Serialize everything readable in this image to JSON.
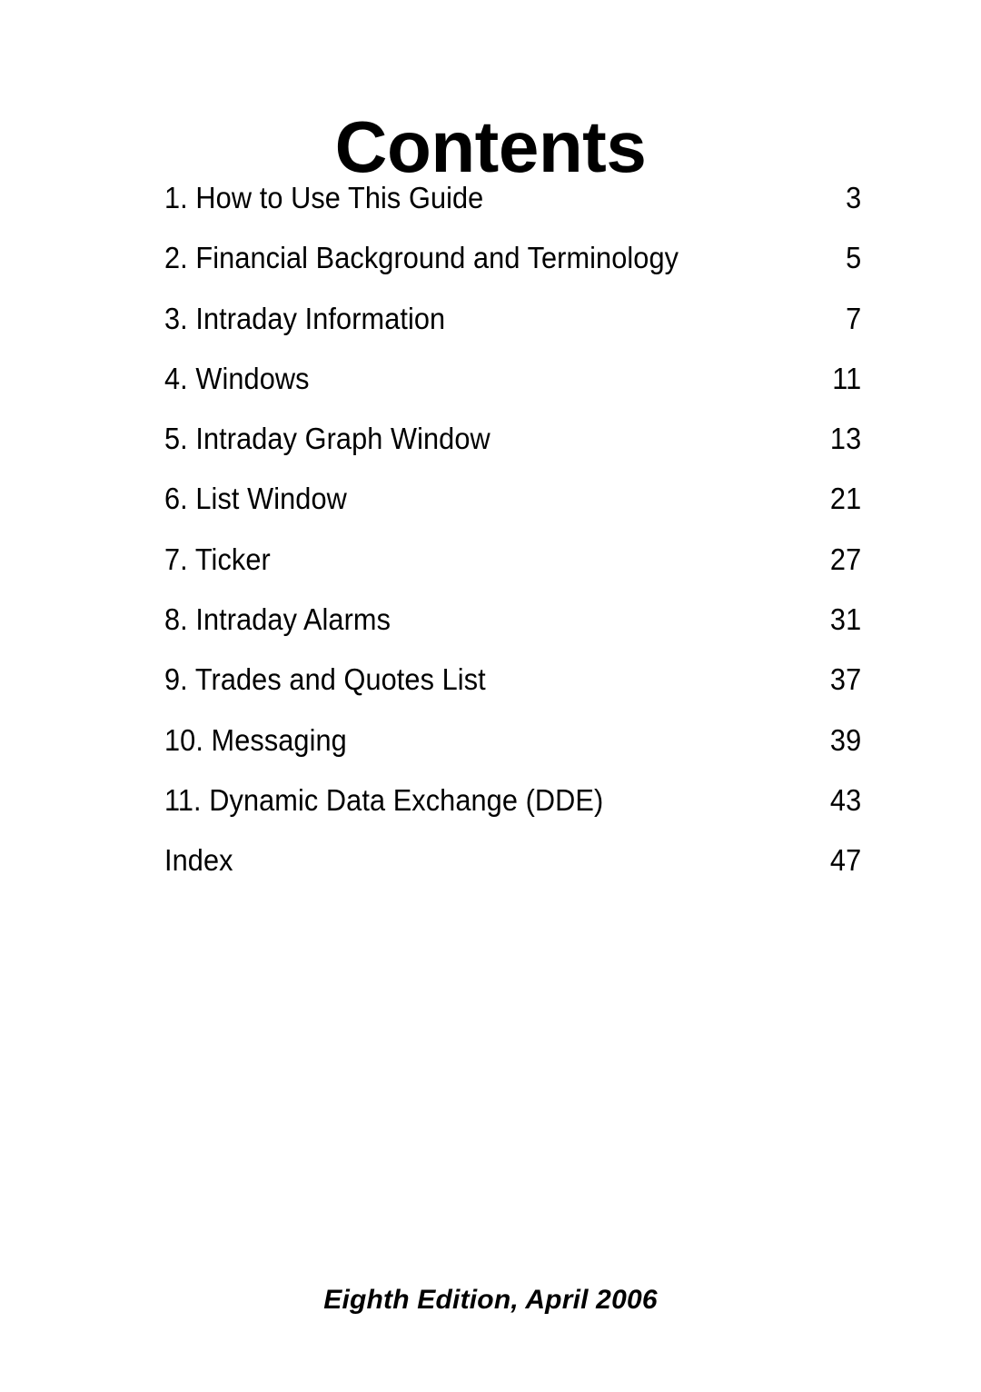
{
  "document": {
    "title": "Contents",
    "edition_note": "Eighth Edition, April 2006"
  },
  "toc": {
    "entries": [
      {
        "label": "1. How to Use This Guide",
        "page": "3"
      },
      {
        "label": "2. Financial Background and Terminology",
        "page": "5"
      },
      {
        "label": "3. Intraday Information",
        "page": "7"
      },
      {
        "label": "4. Windows",
        "page": "11"
      },
      {
        "label": "5. Intraday Graph Window",
        "page": "13"
      },
      {
        "label": "6. List Window",
        "page": "21"
      },
      {
        "label": "7. Ticker",
        "page": "27"
      },
      {
        "label": "8. Intraday Alarms",
        "page": "31"
      },
      {
        "label": "9. Trades and Quotes List",
        "page": "37"
      },
      {
        "label": "10. Messaging",
        "page": "39"
      },
      {
        "label": "11. Dynamic Data Exchange (DDE)",
        "page": "43"
      },
      {
        "label": "Index",
        "page": "47"
      }
    ]
  }
}
